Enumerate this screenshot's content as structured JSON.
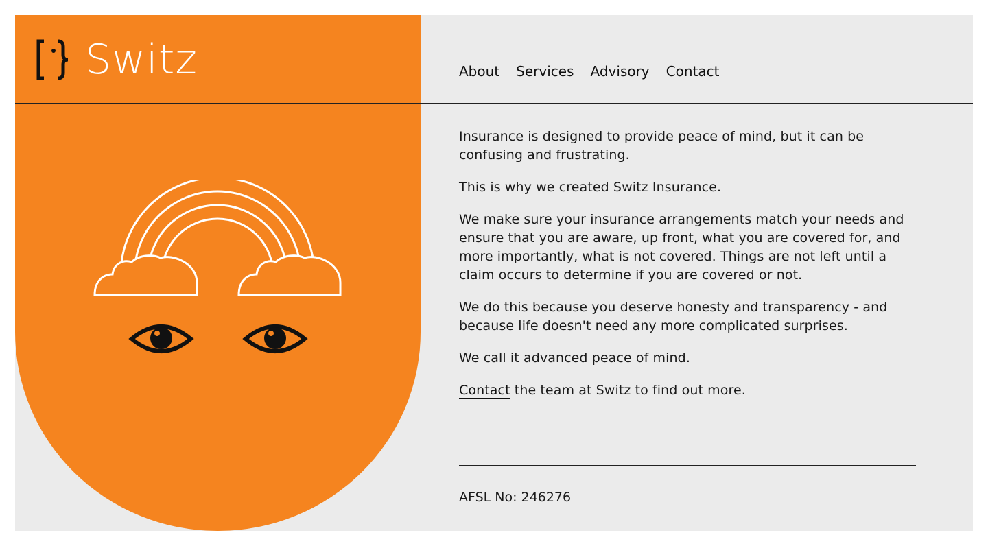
{
  "brand": {
    "name": "Switz",
    "colors": {
      "orange": "#f5841f",
      "panel_bg": "#ebebeb",
      "text": "#111111"
    },
    "logo_icon": "bracket-brace-icon"
  },
  "nav": {
    "items": [
      {
        "label": "About"
      },
      {
        "label": "Services"
      },
      {
        "label": "Advisory"
      },
      {
        "label": "Contact"
      }
    ]
  },
  "illustration": {
    "icons": [
      "rainbow-icon",
      "cloud-icon",
      "eye-icon"
    ]
  },
  "content": {
    "p1": "Insurance is designed to provide peace of mind, but it can be confusing and frustrating.",
    "p2": "This is why we created Switz Insurance.",
    "p3": "We make sure your insurance arrangements match your needs and ensure that you are aware, up front, what you are covered for, and more importantly, what is not covered. Things are not left until a claim occurs to determine if you are covered or not.",
    "p4": "We do this because you deserve honesty and transparency - and because life doesn't need any more complicated surprises.",
    "p5": "We call it advanced peace of mind.",
    "p6_link": "Contact",
    "p6_rest": " the team at Switz to find out more."
  },
  "footer": {
    "afsl": "AFSL No: 246276"
  }
}
